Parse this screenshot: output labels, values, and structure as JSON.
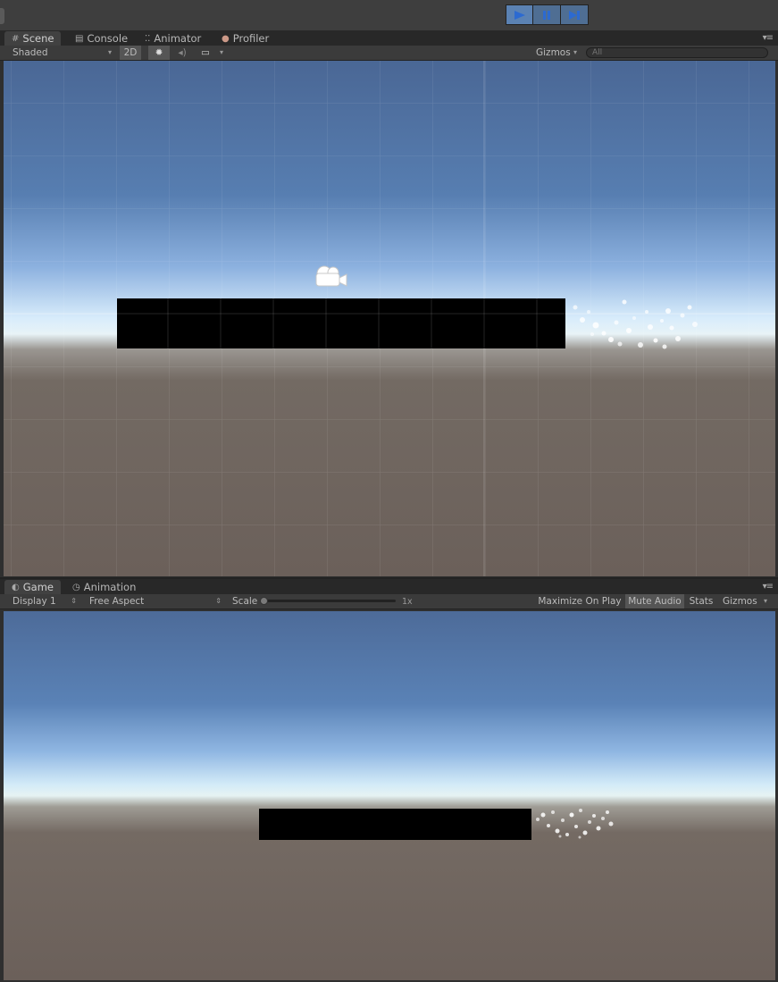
{
  "toolbar": {
    "play_controls": [
      {
        "name": "play-button",
        "icon": "play-icon",
        "active": true
      },
      {
        "name": "pause-button",
        "icon": "pause-icon",
        "active": false
      },
      {
        "name": "step-button",
        "icon": "step-icon",
        "active": false
      }
    ]
  },
  "scene_panel": {
    "tabs": [
      {
        "label": "Scene",
        "icon": "grid-hash-icon",
        "active": true
      },
      {
        "label": "Console",
        "icon": "console-icon",
        "active": false
      },
      {
        "label": "Animator",
        "icon": "animator-icon",
        "active": false
      },
      {
        "label": "Profiler",
        "icon": "profiler-icon",
        "active": false
      }
    ],
    "shading_mode": "Shaded",
    "mode_2d": "2D",
    "gizmos_label": "Gizmos",
    "search_placeholder": "All"
  },
  "game_panel": {
    "tabs": [
      {
        "label": "Game",
        "icon": "game-icon",
        "active": true
      },
      {
        "label": "Animation",
        "icon": "animation-clock-icon",
        "active": false
      }
    ],
    "display": "Display 1",
    "aspect": "Free Aspect",
    "scale_label": "Scale",
    "scale_value": "1x",
    "scale_level": 0,
    "maximize_label": "Maximize On Play",
    "mute_label": "Mute Audio",
    "stats_label": "Stats",
    "gizmos_label": "Gizmos"
  },
  "colors": {
    "sky_top": "#4d6b99",
    "horizon": "#dcefff",
    "ground": "#6b605a",
    "accent_play": "#5b82b3"
  }
}
